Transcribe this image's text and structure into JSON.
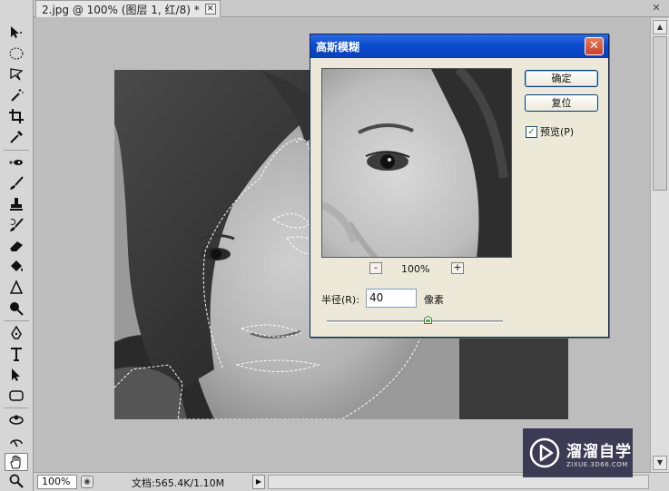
{
  "document": {
    "tab_title": "2.jpg @ 100% (图层 1, 红/8) *",
    "close_glyph": "✕"
  },
  "toolbox": {
    "tools": [
      {
        "name": "move-tool-icon"
      },
      {
        "name": "marquee-tool-icon"
      },
      {
        "name": "lasso-tool-icon"
      },
      {
        "name": "magic-wand-tool-icon"
      },
      {
        "name": "crop-tool-icon"
      },
      {
        "name": "eyedropper-tool-icon"
      },
      {
        "name": "spot-healing-tool-icon"
      },
      {
        "name": "brush-tool-icon"
      },
      {
        "name": "clone-stamp-tool-icon"
      },
      {
        "name": "history-brush-tool-icon"
      },
      {
        "name": "eraser-tool-icon"
      },
      {
        "name": "paint-bucket-tool-icon"
      },
      {
        "name": "blur-tool-icon"
      },
      {
        "name": "dodge-tool-icon"
      },
      {
        "name": "pen-tool-icon"
      },
      {
        "name": "type-tool-icon"
      },
      {
        "name": "path-selection-tool-icon"
      },
      {
        "name": "shape-tool-icon"
      },
      {
        "name": "3d-rotate-tool-icon"
      },
      {
        "name": "3d-orbit-tool-icon"
      },
      {
        "name": "hand-tool-icon",
        "active": true
      },
      {
        "name": "zoom-tool-icon"
      }
    ]
  },
  "status": {
    "zoom": "100%",
    "doc_info": "文档:565.4K/1.10M",
    "arrow": "▶"
  },
  "dialog": {
    "title": "高斯模糊",
    "close_glyph": "✕",
    "ok_label": "确定",
    "reset_label": "复位",
    "preview_label": "预览(P)",
    "preview_checked": true,
    "check_glyph": "✓",
    "zoom_out": "-",
    "zoom_in": "+",
    "zoom_percent": "100%",
    "radius_label": "半径(R):",
    "radius_value": "40",
    "unit_label": "像素"
  },
  "watermark": {
    "brand": "溜溜自学",
    "url": "ZIXUE.3D66.COM"
  }
}
